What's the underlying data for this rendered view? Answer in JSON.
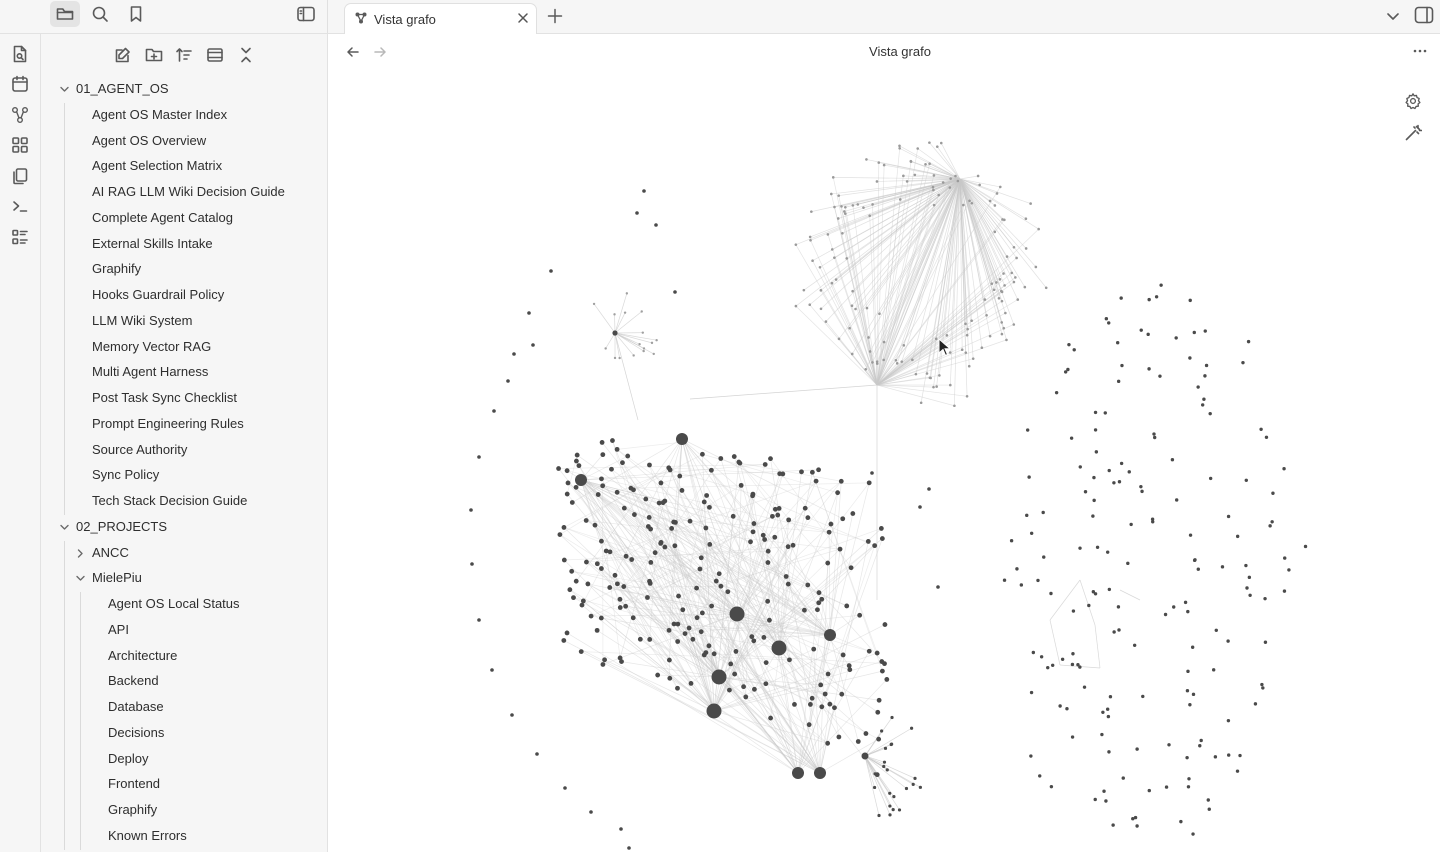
{
  "tabs": [
    {
      "label": "Vista grafo",
      "active": true
    }
  ],
  "header": {
    "title": "Vista grafo"
  },
  "explorer": {
    "folders": [
      {
        "label": "01_AGENT_OS",
        "expanded": true,
        "files": [
          "Agent OS Master Index",
          "Agent OS Overview",
          "Agent Selection Matrix",
          "AI RAG LLM Wiki Decision Guide",
          "Complete Agent Catalog",
          "External Skills Intake",
          "Graphify",
          "Hooks Guardrail Policy",
          "LLM Wiki System",
          "Memory Vector RAG",
          "Multi Agent Harness",
          "Post Task Sync Checklist",
          "Prompt Engineering Rules",
          "Source Authority",
          "Sync Policy",
          "Tech Stack Decision Guide"
        ]
      },
      {
        "label": "02_PROJECTS",
        "expanded": true,
        "subfolders": [
          {
            "label": "ANCC",
            "expanded": false,
            "files": []
          },
          {
            "label": "MielePiu",
            "expanded": true,
            "files": [
              "Agent OS Local Status",
              "API",
              "Architecture",
              "Backend",
              "Database",
              "Decisions",
              "Deploy",
              "Frontend",
              "Graphify",
              "Known Errors"
            ]
          }
        ]
      }
    ]
  },
  "icons": {
    "topbar": [
      "folder-icon",
      "search-icon",
      "bookmark-icon",
      "sidebar-toggle-icon"
    ],
    "ribbon": [
      "file-search-icon",
      "calendar-icon",
      "graph-icon",
      "grid-icon",
      "copy-icon",
      "terminal-icon",
      "list-icon"
    ],
    "explorer_actions": [
      "new-note-icon",
      "new-folder-icon",
      "sort-icon",
      "expand-icon",
      "collapse-icon"
    ]
  },
  "colors": {
    "node": "#4a4a4a",
    "edge": "#c9c9c9",
    "background": "#ffffff",
    "chrome": "#f6f6f6"
  }
}
